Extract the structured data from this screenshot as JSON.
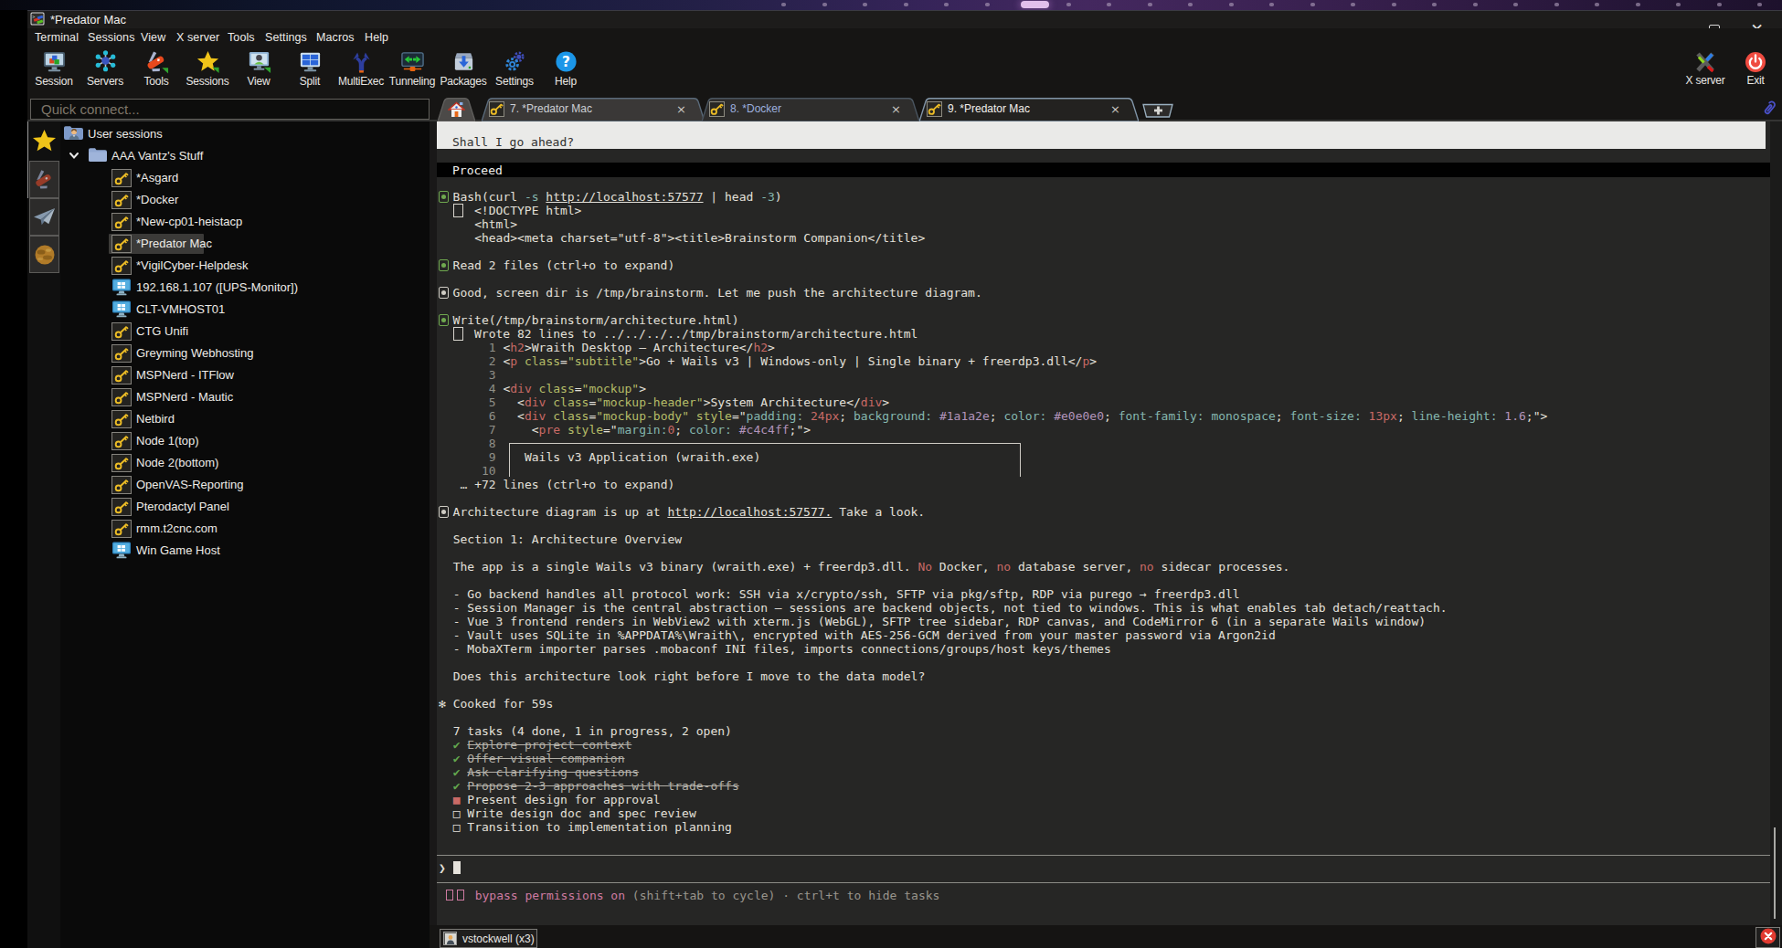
{
  "window": {
    "title": "*Predator Mac"
  },
  "menu": {
    "items": [
      "Terminal",
      "Sessions",
      "View",
      "X server",
      "Tools",
      "Settings",
      "Macros",
      "Help"
    ]
  },
  "toolbar": {
    "buttons": [
      {
        "label": "Session",
        "icon": "session-icon"
      },
      {
        "label": "Servers",
        "icon": "servers-icon"
      },
      {
        "label": "Tools",
        "icon": "tools-icon"
      },
      {
        "label": "Sessions",
        "icon": "sessions-star-icon"
      },
      {
        "label": "View",
        "icon": "view-icon"
      },
      {
        "label": "Split",
        "icon": "split-icon"
      },
      {
        "label": "MultiExec",
        "icon": "multiexec-icon"
      },
      {
        "label": "Tunneling",
        "icon": "tunneling-icon"
      },
      {
        "label": "Packages",
        "icon": "packages-icon"
      },
      {
        "label": "Settings",
        "icon": "settings-icon"
      },
      {
        "label": "Help",
        "icon": "help-icon"
      }
    ],
    "right_buttons": [
      {
        "label": "X server",
        "icon": "xserver-icon"
      },
      {
        "label": "Exit",
        "icon": "exit-icon"
      }
    ]
  },
  "quick_connect": {
    "placeholder": "Quick connect..."
  },
  "tabs": {
    "items": [
      {
        "label": "7. *Predator Mac",
        "state": "normal",
        "icon": "key-icon",
        "close": "×"
      },
      {
        "label": "8. *Docker",
        "state": "activity",
        "icon": "key-icon",
        "close": "×"
      },
      {
        "label": "9. *Predator Mac",
        "state": "active",
        "icon": "key-icon",
        "close": "×"
      }
    ]
  },
  "sidebar": {
    "rail": [
      {
        "icon": "star-icon",
        "active": true
      },
      {
        "icon": "knife-icon"
      },
      {
        "icon": "plane-icon"
      },
      {
        "icon": "globe-icon"
      }
    ],
    "header": {
      "label": "User sessions",
      "icon": "user-folder-icon"
    },
    "group": {
      "label": "AAA Vantz's Stuff",
      "icon": "folder-icon",
      "expanded": true
    },
    "sessions": [
      {
        "label": "*Asgard",
        "icon": "key"
      },
      {
        "label": "*Docker",
        "icon": "key"
      },
      {
        "label": "*New-cp01-heistacp",
        "icon": "key"
      },
      {
        "label": "*Predator Mac",
        "icon": "key",
        "selected": true
      },
      {
        "label": "*VigilCyber-Helpdesk",
        "icon": "key"
      },
      {
        "label": "192.168.1.107 ([UPS-Monitor])",
        "icon": "rdp"
      },
      {
        "label": "CLT-VMHOST01",
        "icon": "rdp"
      },
      {
        "label": "CTG Unifi",
        "icon": "key"
      },
      {
        "label": "Greyming Webhosting",
        "icon": "key"
      },
      {
        "label": "MSPNerd - ITFlow",
        "icon": "key"
      },
      {
        "label": "MSPNerd - Mautic",
        "icon": "key"
      },
      {
        "label": "Netbird",
        "icon": "key"
      },
      {
        "label": "Node 1(top)",
        "icon": "key"
      },
      {
        "label": "Node 2(bottom)",
        "icon": "key"
      },
      {
        "label": "OpenVAS-Reporting",
        "icon": "key"
      },
      {
        "label": "Pterodactyl Panel",
        "icon": "key"
      },
      {
        "label": "rmm.t2cnc.com",
        "icon": "key"
      },
      {
        "label": "Win Game Host",
        "icon": "rdp"
      }
    ]
  },
  "terminal": {
    "question": "Shall I go ahead?",
    "selected_option": "Proceed",
    "rows": [
      {
        "r": 6,
        "segs": [
          {
            "b": "g"
          },
          {
            "t": "Bash(curl "
          },
          {
            "t": "-s",
            "c": "cy"
          },
          {
            "t": " "
          },
          {
            "t": "http://localhost:57577",
            "c": "lk"
          },
          {
            "t": " | head "
          },
          {
            "t": "-3",
            "c": "cy"
          },
          {
            "t": ")"
          }
        ]
      },
      {
        "r": 7,
        "segs": [
          {
            "t": "  "
          },
          {
            "x": "rbox"
          },
          {
            "t": "<!DOCTYPE html>"
          }
        ]
      },
      {
        "r": 8,
        "segs": [
          {
            "t": "     <html>"
          }
        ]
      },
      {
        "r": 9,
        "segs": [
          {
            "t": "     <head><meta charset=\"utf-8\"><title>Brainstorm Companion</title>"
          }
        ]
      },
      {
        "r": 11,
        "segs": [
          {
            "b": "g"
          },
          {
            "t": "Read 2 files (ctrl+o to expand)"
          }
        ]
      },
      {
        "r": 13,
        "segs": [
          {
            "b": "w"
          },
          {
            "t": "Good, screen dir is /tmp/brainstorm. Let me push the architecture diagram."
          }
        ]
      },
      {
        "r": 15,
        "segs": [
          {
            "b": "g"
          },
          {
            "t": "Write(/tmp/brainstorm/architecture.html)"
          }
        ]
      },
      {
        "r": 16,
        "segs": [
          {
            "t": "  "
          },
          {
            "x": "rbox"
          },
          {
            "t": "Wrote 82 lines to ../../../../tmp/brainstorm/architecture.html"
          }
        ]
      },
      {
        "r": 17,
        "segs": [
          {
            "t": "       1 ",
            "c": "gy"
          },
          {
            "t": "<"
          },
          {
            "t": "h2",
            "c": "rd"
          },
          {
            "t": ">"
          },
          {
            "t": "Wraith Desktop — Architecture"
          },
          {
            "t": "</"
          },
          {
            "t": "h2",
            "c": "rd"
          },
          {
            "t": ">"
          }
        ]
      },
      {
        "r": 18,
        "segs": [
          {
            "t": "       2 ",
            "c": "gy"
          },
          {
            "t": "<"
          },
          {
            "t": "p",
            "c": "rd"
          },
          {
            "t": " "
          },
          {
            "t": "class",
            "c": "gn"
          },
          {
            "t": "="
          },
          {
            "t": "\"subtitle\"",
            "c": "gn"
          },
          {
            "t": ">"
          },
          {
            "t": "Go + Wails v3 | Windows-only | Single binary + freerdp3.dll"
          },
          {
            "t": "</"
          },
          {
            "t": "p",
            "c": "rd"
          },
          {
            "t": ">"
          }
        ]
      },
      {
        "r": 19,
        "segs": [
          {
            "t": "       3",
            "c": "gy"
          }
        ]
      },
      {
        "r": 20,
        "segs": [
          {
            "t": "       4 ",
            "c": "gy"
          },
          {
            "t": "<"
          },
          {
            "t": "div",
            "c": "rd"
          },
          {
            "t": " "
          },
          {
            "t": "class",
            "c": "gn"
          },
          {
            "t": "="
          },
          {
            "t": "\"mockup\"",
            "c": "gn"
          },
          {
            "t": ">"
          }
        ]
      },
      {
        "r": 21,
        "segs": [
          {
            "t": "       5 ",
            "c": "gy"
          },
          {
            "t": "  <"
          },
          {
            "t": "div",
            "c": "rd"
          },
          {
            "t": " "
          },
          {
            "t": "class",
            "c": "gn"
          },
          {
            "t": "="
          },
          {
            "t": "\"mockup-header\"",
            "c": "gn"
          },
          {
            "t": ">"
          },
          {
            "t": "System Architecture"
          },
          {
            "t": "</"
          },
          {
            "t": "div",
            "c": "rd"
          },
          {
            "t": ">"
          }
        ]
      },
      {
        "r": 22,
        "segs": [
          {
            "t": "       6 ",
            "c": "gy"
          },
          {
            "t": "  <"
          },
          {
            "t": "div",
            "c": "rd"
          },
          {
            "t": " "
          },
          {
            "t": "class",
            "c": "gn"
          },
          {
            "t": "="
          },
          {
            "t": "\"mockup-body\"",
            "c": "gn"
          },
          {
            "t": " "
          },
          {
            "t": "style",
            "c": "gn"
          },
          {
            "t": "=\""
          },
          {
            "t": "padding:",
            "c": "cy"
          },
          {
            "t": " "
          },
          {
            "t": "24px",
            "c": "rd"
          },
          {
            "t": "; "
          },
          {
            "t": "background:",
            "c": "cy"
          },
          {
            "t": " "
          },
          {
            "t": "#1a1a2e",
            "c": "pu"
          },
          {
            "t": "; "
          },
          {
            "t": "color:",
            "c": "cy"
          },
          {
            "t": " "
          },
          {
            "t": "#e0e0e0",
            "c": "pu"
          },
          {
            "t": "; "
          },
          {
            "t": "font-family:",
            "c": "cy"
          },
          {
            "t": " "
          },
          {
            "t": "monospace",
            "c": "cy"
          },
          {
            "t": "; "
          },
          {
            "t": "font-size:",
            "c": "cy"
          },
          {
            "t": " "
          },
          {
            "t": "13px",
            "c": "rd"
          },
          {
            "t": "; "
          },
          {
            "t": "line-height:",
            "c": "cy"
          },
          {
            "t": " "
          },
          {
            "t": "1.6",
            "c": "pu"
          },
          {
            "t": ";\">"
          }
        ]
      },
      {
        "r": 23,
        "segs": [
          {
            "t": "       7 ",
            "c": "gy"
          },
          {
            "t": "    <"
          },
          {
            "t": "pre",
            "c": "rd"
          },
          {
            "t": " "
          },
          {
            "t": "style",
            "c": "gn"
          },
          {
            "t": "=\""
          },
          {
            "t": "margin:",
            "c": "cy"
          },
          {
            "t": "0",
            "c": "rd"
          },
          {
            "t": "; "
          },
          {
            "t": "color:",
            "c": "cy"
          },
          {
            "t": " "
          },
          {
            "t": "#c4c4ff",
            "c": "pu"
          },
          {
            "t": ";\">"
          }
        ]
      },
      {
        "r": 24,
        "segs": [
          {
            "t": "       8",
            "c": "gy"
          }
        ]
      },
      {
        "r": 25,
        "segs": [
          {
            "t": "       9 ",
            "c": "gy"
          },
          {
            "t": "   Wails v3 Application (wraith.exe)"
          }
        ]
      },
      {
        "r": 26,
        "segs": [
          {
            "t": "      10",
            "c": "gy"
          }
        ]
      },
      {
        "r": 27,
        "segs": [
          {
            "t": "   … +72 lines (ctrl+o to expand)"
          }
        ]
      },
      {
        "r": 29,
        "segs": [
          {
            "b": "w"
          },
          {
            "t": "Architecture diagram is up at "
          },
          {
            "t": "http://localhost:57577.",
            "c": "lk"
          },
          {
            "t": " Take a look."
          }
        ]
      },
      {
        "r": 31,
        "segs": [
          {
            "t": "  Section 1: Architecture Overview"
          }
        ]
      },
      {
        "r": 33,
        "segs": [
          {
            "t": "  The app is a single Wails v3 binary (wraith.exe) + freerdp3.dll. "
          },
          {
            "t": "No",
            "c": "rd"
          },
          {
            "t": " Docker, "
          },
          {
            "t": "no",
            "c": "rd"
          },
          {
            "t": " database server, "
          },
          {
            "t": "no",
            "c": "rd"
          },
          {
            "t": " sidecar processes."
          }
        ]
      },
      {
        "r": 35,
        "segs": [
          {
            "t": "  - Go backend handles all protocol work: SSH via x/crypto/ssh, SFTP via pkg/sftp, RDP via purego → freerdp3.dll"
          }
        ]
      },
      {
        "r": 36,
        "segs": [
          {
            "t": "  - Session Manager is the central abstraction — sessions are backend objects, not tied to windows. This is what enables tab detach/reattach."
          }
        ]
      },
      {
        "r": 37,
        "segs": [
          {
            "t": "  - Vue 3 frontend renders in WebView2 with xterm.js (WebGL), SFTP tree sidebar, RDP canvas, and CodeMirror 6 (in a separate Wails window)"
          }
        ]
      },
      {
        "r": 38,
        "segs": [
          {
            "t": "  - Vault uses SQLite in %APPDATA%\\Wraith\\, encrypted with AES-256-GCM derived from your master password via Argon2id"
          }
        ]
      },
      {
        "r": 39,
        "segs": [
          {
            "t": "  - MobaXTerm importer parses .mobaconf INI files, imports connections/groups/host keys/themes"
          }
        ]
      },
      {
        "r": 41,
        "segs": [
          {
            "t": "  Does this architecture look right before I move to the data model?"
          }
        ]
      },
      {
        "r": 43,
        "segs": [
          {
            "t": "✻ Cooked for 59s"
          }
        ]
      },
      {
        "r": 45,
        "segs": [
          {
            "t": "  7 tasks (4 done, 1 in progress, 2 open)"
          }
        ]
      },
      {
        "r": 46,
        "segs": [
          {
            "t": "  "
          },
          {
            "t": "✔",
            "c": "gch"
          },
          {
            "t": " "
          },
          {
            "t": "Explore project context",
            "c": "st"
          }
        ]
      },
      {
        "r": 47,
        "segs": [
          {
            "t": "  "
          },
          {
            "t": "✔",
            "c": "gch"
          },
          {
            "t": " "
          },
          {
            "t": "Offer visual companion",
            "c": "st"
          }
        ]
      },
      {
        "r": 48,
        "segs": [
          {
            "t": "  "
          },
          {
            "t": "✔",
            "c": "gch"
          },
          {
            "t": " "
          },
          {
            "t": "Ask clarifying questions",
            "c": "st"
          }
        ]
      },
      {
        "r": 49,
        "segs": [
          {
            "t": "  "
          },
          {
            "t": "✔",
            "c": "gch"
          },
          {
            "t": " "
          },
          {
            "t": "Propose 2-3 approaches with trade-offs",
            "c": "st"
          }
        ]
      },
      {
        "r": 50,
        "segs": [
          {
            "t": "  "
          },
          {
            "t": "■",
            "c": "sq"
          },
          {
            "t": " Present design for approval"
          }
        ]
      },
      {
        "r": 51,
        "segs": [
          {
            "t": "  □ Write design doc and spec review"
          }
        ]
      },
      {
        "r": 52,
        "segs": [
          {
            "t": "  □ Transition to implementation planning"
          }
        ]
      },
      {
        "r": 55,
        "segs": [
          {
            "t": "❯ "
          },
          {
            "x": "cur"
          }
        ]
      },
      {
        "r": 57,
        "segs": [
          {
            "t": " "
          },
          {
            "x": "pb"
          },
          {
            "x": "pb"
          },
          {
            "t": " "
          },
          {
            "t": "bypass permissions on",
            "c": "pk"
          },
          {
            "t": " (shift+tab to cycle) · ctrl+t to hide tasks",
            "c": "gy2"
          }
        ]
      }
    ]
  },
  "status_bar": {
    "session_group": "vstockwell (x3)",
    "close_icon": "close-circle-icon"
  }
}
